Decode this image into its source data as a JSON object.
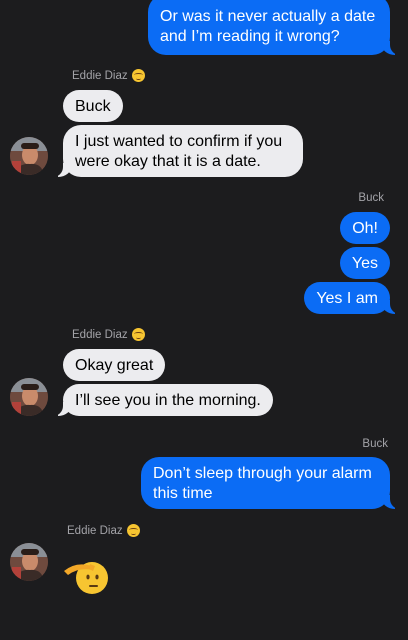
{
  "conversation": {
    "messages": [
      {
        "text": "Or was it never actually a date\nand I’m reading it wrong?"
      },
      {
        "text": "Buck"
      },
      {
        "text": "I just wanted to confirm if you\nwere okay that it is a date."
      },
      {
        "text": "Oh!"
      },
      {
        "text": "Yes"
      },
      {
        "text": "Yes I am"
      },
      {
        "text": "Okay great"
      },
      {
        "text": "I’ll see you in the morning."
      },
      {
        "text": "Don’t sleep through your alarm\nthis time"
      }
    ],
    "senders": {
      "eddie_1": "Eddie Diaz",
      "buck_1": "Buck",
      "eddie_2": "Eddie Diaz",
      "buck_2": "Buck",
      "eddie_3": "Eddie Diaz"
    },
    "sender_emoji": "grimacing-face-emoji",
    "last_message_emoji": "saluting-face-emoji"
  },
  "colors": {
    "background": "#1c1c1e",
    "sent_bubble": "#0b6cf5",
    "received_bubble": "#ececef",
    "sender_name": "#a3a3a8"
  }
}
